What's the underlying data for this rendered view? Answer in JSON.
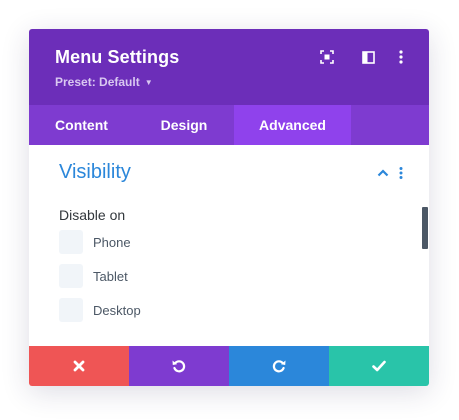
{
  "header": {
    "title": "Menu Settings",
    "preset_label": "Preset: Default",
    "icons": [
      "expand-icon",
      "sidebar-icon",
      "more-vertical-icon"
    ]
  },
  "tabs": [
    {
      "label": "Content",
      "active": false
    },
    {
      "label": "Design",
      "active": false
    },
    {
      "label": "Advanced",
      "active": true
    }
  ],
  "section": {
    "title": "Visibility",
    "field_label": "Disable on",
    "options": [
      {
        "label": "Phone",
        "checked": false
      },
      {
        "label": "Tablet",
        "checked": false
      },
      {
        "label": "Desktop",
        "checked": false
      }
    ]
  },
  "footer": {
    "buttons": [
      {
        "name": "cancel",
        "icon": "close-icon",
        "color": "#ef5555"
      },
      {
        "name": "undo",
        "icon": "undo-icon",
        "color": "#7e3bd0"
      },
      {
        "name": "redo",
        "icon": "redo-icon",
        "color": "#2b87da"
      },
      {
        "name": "save",
        "icon": "check-icon",
        "color": "#29c4a9"
      }
    ]
  },
  "colors": {
    "header": "#6c2eb9",
    "tabs": "#7e3bd0",
    "active_tab": "#8f42ec",
    "section_title": "#2b87da"
  }
}
